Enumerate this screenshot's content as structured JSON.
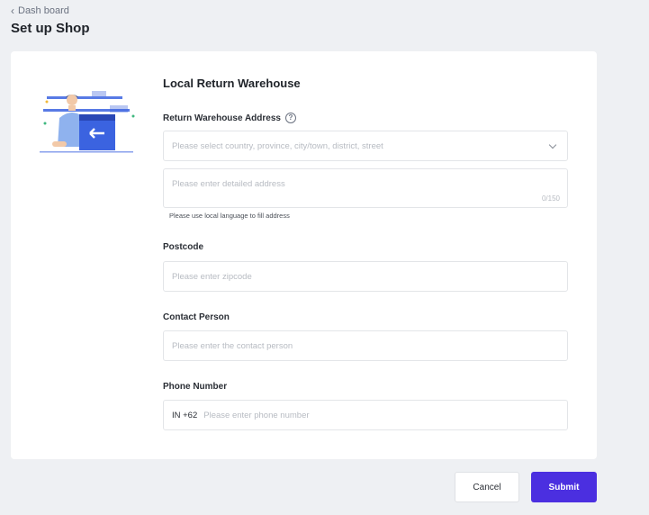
{
  "breadcrumb": {
    "back_label": "Dash board"
  },
  "page": {
    "title": "Set up Shop"
  },
  "form": {
    "section_title": "Local Return Warehouse",
    "address": {
      "label": "Return Warehouse Address",
      "region_placeholder": "Please select country, province, city/town, district, street",
      "detail_placeholder": "Please enter detailed address",
      "counter": "0/150",
      "hint": "Please use local language to fill address"
    },
    "postcode": {
      "label": "Postcode",
      "placeholder": "Please enter zipcode"
    },
    "contact": {
      "label": "Contact Person",
      "placeholder": "Please enter the contact person"
    },
    "phone": {
      "label": "Phone Number",
      "prefix": "IN +62",
      "placeholder": "Please enter phone number"
    }
  },
  "actions": {
    "cancel_label": "Cancel",
    "submit_label": "Submit"
  },
  "icons": {
    "back": "chevron-left-icon",
    "help": "question-circle-icon",
    "dropdown": "chevron-down-icon",
    "illustration": "warehouse-return-illustration"
  },
  "colors": {
    "primary": "#4b2fe0",
    "background": "#eef0f3",
    "illustration_blue": "#3b63e0"
  }
}
